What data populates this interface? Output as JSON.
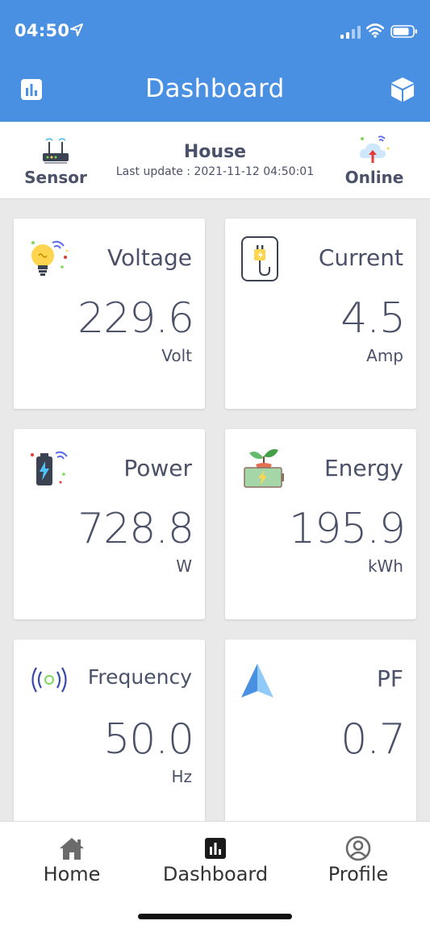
{
  "status_bar": {
    "time": "04:50"
  },
  "header": {
    "title": "Dashboard"
  },
  "info_bar": {
    "sensor_label": "Sensor",
    "house_name": "House",
    "last_update": "Last update : 2021-11-12 04:50:01",
    "status_label": "Online"
  },
  "cards": [
    {
      "label": "Voltage",
      "value": "229.6",
      "unit": "Volt",
      "icon": "lightbulb-icon"
    },
    {
      "label": "Current",
      "value": "4.5",
      "unit": "Amp",
      "icon": "plug-icon"
    },
    {
      "label": "Power",
      "value": "728.8",
      "unit": "W",
      "icon": "battery-icon"
    },
    {
      "label": "Energy",
      "value": "195.9",
      "unit": "kWh",
      "icon": "eco-battery-icon"
    },
    {
      "label": "Frequency",
      "value": "50.0",
      "unit": "Hz",
      "icon": "signal-waves-icon"
    },
    {
      "label": "PF",
      "value": "0.7",
      "unit": "",
      "icon": "navigation-arrow-icon"
    }
  ],
  "tabs": [
    {
      "label": "Home",
      "icon": "home-icon"
    },
    {
      "label": "Dashboard",
      "icon": "chart-icon"
    },
    {
      "label": "Profile",
      "icon": "user-circle-icon"
    }
  ],
  "colors": {
    "header_bg": "#4a90e2",
    "text": "#4a5168",
    "background": "#e9e9ea"
  }
}
